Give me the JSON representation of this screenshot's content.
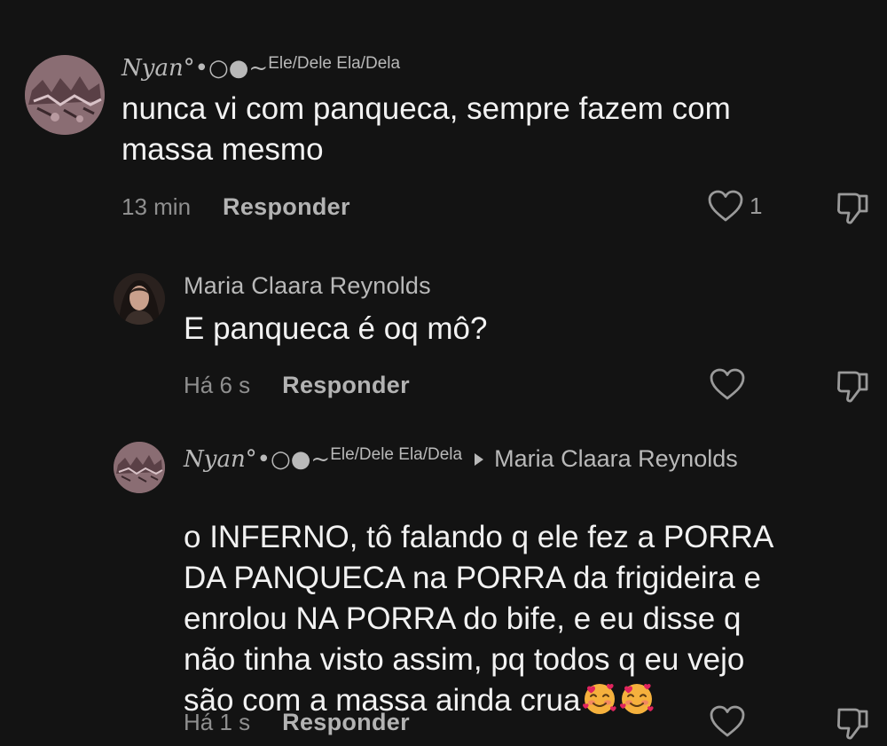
{
  "comments": [
    {
      "author_nick": "Nyan°•○●~",
      "author_pronouns": "Ele/Dele Ela/Dela",
      "text": "nunca vi com panqueca, sempre fazem com\nmassa mesmo",
      "time": "13 min",
      "reply_label": "Responder",
      "like_count": "1"
    },
    {
      "author_name": "Maria Claara Reynolds",
      "text": "E panqueca é oq mô?",
      "time": "Há 6 s",
      "reply_label": "Responder"
    },
    {
      "author_nick": "Nyan°•○●~",
      "author_pronouns": "Ele/Dele Ela/Dela",
      "reply_to": "Maria Claara Reynolds",
      "text": "o INFERNO, tô falando q ele fez a PORRA\nDA PANQUECA na PORRA da frigideira e\nenrolou NA PORRA do bife, e eu disse q\nnão tinha visto assim, pq todos q eu vejo\nsão com a massa ainda crua",
      "emoji": [
        "smiling-face-with-hearts",
        "smiling-face-with-hearts"
      ],
      "time": "Há 1 s",
      "reply_label": "Responder"
    }
  ],
  "icons": {
    "like": "heart-outline-icon",
    "dislike": "thumbs-down-outline-icon"
  },
  "colors": {
    "background": "#131313",
    "text": "#f2f2f2",
    "secondary": "#b9b9b9",
    "muted": "#8f8f8f",
    "emoji": "#f5b13d",
    "hearts": "#e0245e"
  }
}
